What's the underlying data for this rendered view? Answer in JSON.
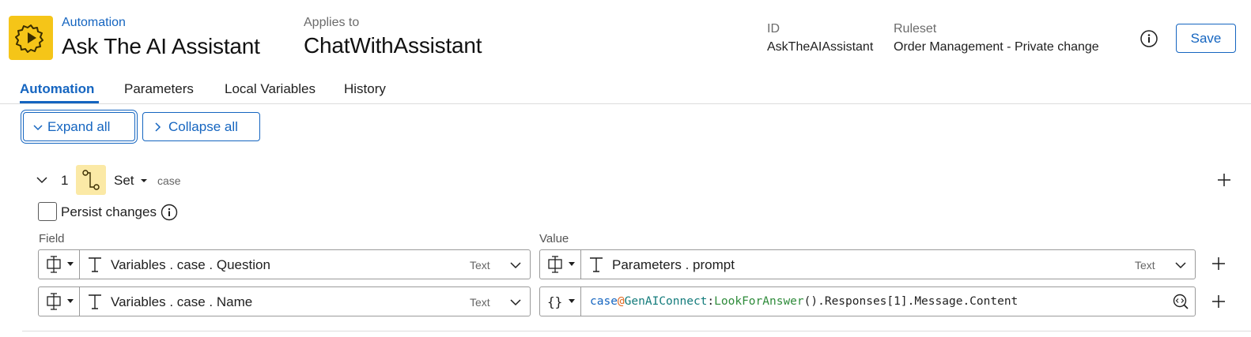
{
  "header": {
    "category_label": "Automation",
    "title": "Ask The AI Assistant",
    "applies_to_label": "Applies to",
    "applies_to_value": "ChatWithAssistant",
    "id_label": "ID",
    "id_value": "AskTheAIAssistant",
    "ruleset_label": "Ruleset",
    "ruleset_value": "Order Management - Private change",
    "save_label": "Save"
  },
  "tabs": [
    {
      "label": "Automation",
      "active": true
    },
    {
      "label": "Parameters",
      "active": false
    },
    {
      "label": "Local Variables",
      "active": false
    },
    {
      "label": "History",
      "active": false
    }
  ],
  "toolbar": {
    "expand_label": "Expand all",
    "collapse_label": "Collapse all"
  },
  "step": {
    "number": "1",
    "action": "Set",
    "target": "case",
    "persist_label": "Persist changes",
    "field_header": "Field",
    "value_header": "Value",
    "rows": [
      {
        "field": "Variables . case . Question",
        "field_type": "Text",
        "value": "Parameters . prompt",
        "value_type": "Text"
      },
      {
        "field": "Variables . case . Name",
        "field_type": "Text",
        "expr": {
          "p1": "case",
          "p2": "@",
          "p3": "GenAIConnect",
          "p4": ":",
          "p5": "LookForAnswer",
          "p6": "().Responses[1].Message.Content"
        }
      }
    ]
  },
  "colors": {
    "accent": "#1565c0",
    "brand_icon_bg": "#f5c518",
    "step_icon_bg": "#fbe9a6"
  },
  "icons": {
    "app": "gear-play-icon",
    "info": "info-icon",
    "step": "flow-icon",
    "mode": "property-select-icon",
    "expression_mode": "braces-icon",
    "text_type": "text-type-icon",
    "expression_builder": "code-search-icon"
  }
}
